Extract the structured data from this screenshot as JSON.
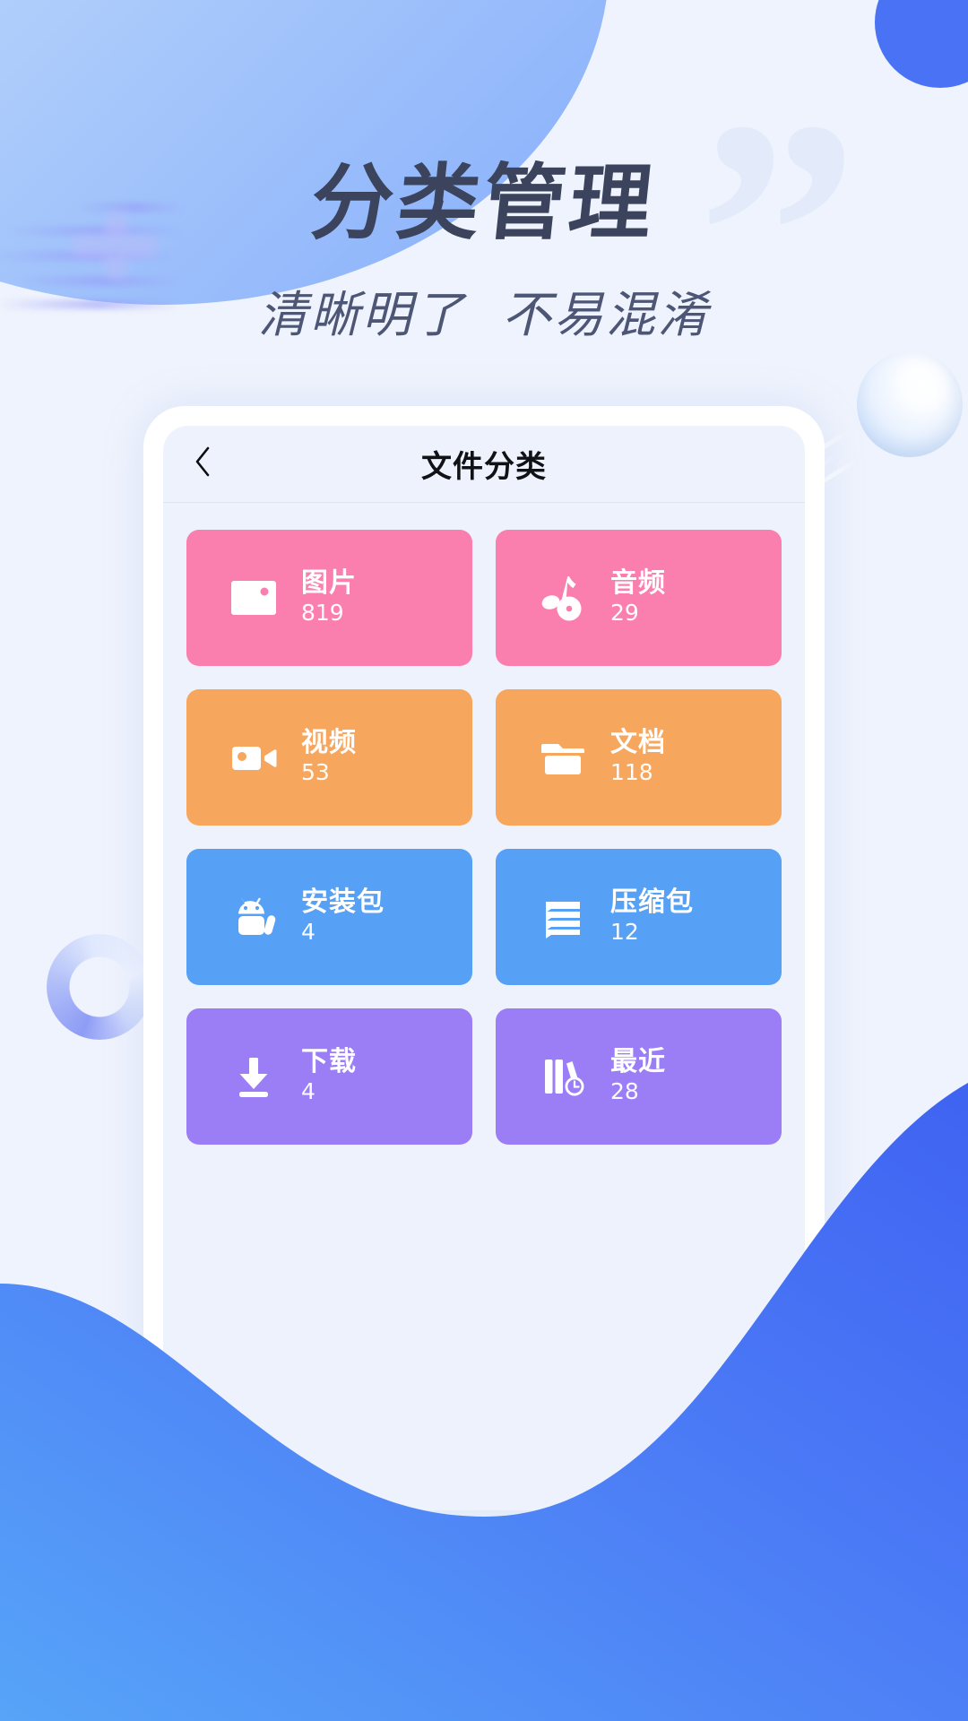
{
  "promo": {
    "headline": "分类管理",
    "subtitle_left": "清晰明了",
    "subtitle_right": "不易混淆"
  },
  "colors": {
    "page_background": "#eff3fd",
    "headline_text": "#3b445c",
    "subtitle_text": "#4d5675",
    "accent_blue": "#4a72f5",
    "wave_blue": "#4a78f7",
    "wave_cyan": "#b4eefb",
    "pink": "#fb7fae",
    "orange": "#f7a65d",
    "blue": "#56a0f5",
    "purple": "#9b7ef6",
    "phone_frame": "#ffffff",
    "screen_background": "#eef2fc"
  },
  "phone": {
    "navbar": {
      "back_icon": "chevron-left-icon",
      "title": "文件分类"
    },
    "categories": [
      {
        "label": "图片",
        "count": "819",
        "icon": "image-icon",
        "color": "#fb7fae"
      },
      {
        "label": "音频",
        "count": "29",
        "icon": "music-disc-icon",
        "color": "#fb7fae"
      },
      {
        "label": "视频",
        "count": "53",
        "icon": "video-camera-icon",
        "color": "#f7a65d"
      },
      {
        "label": "文档",
        "count": "118",
        "icon": "folder-icon",
        "color": "#f7a65d"
      },
      {
        "label": "安装包",
        "count": "4",
        "icon": "android-icon",
        "color": "#56a0f5"
      },
      {
        "label": "压缩包",
        "count": "12",
        "icon": "archive-stack-icon",
        "color": "#56a0f5"
      },
      {
        "label": "下载",
        "count": "4",
        "icon": "download-icon",
        "color": "#9b7ef6"
      },
      {
        "label": "最近",
        "count": "28",
        "icon": "recent-books-clock-icon",
        "color": "#9b7ef6"
      }
    ]
  },
  "decorations": {
    "quote_mark": "”"
  }
}
